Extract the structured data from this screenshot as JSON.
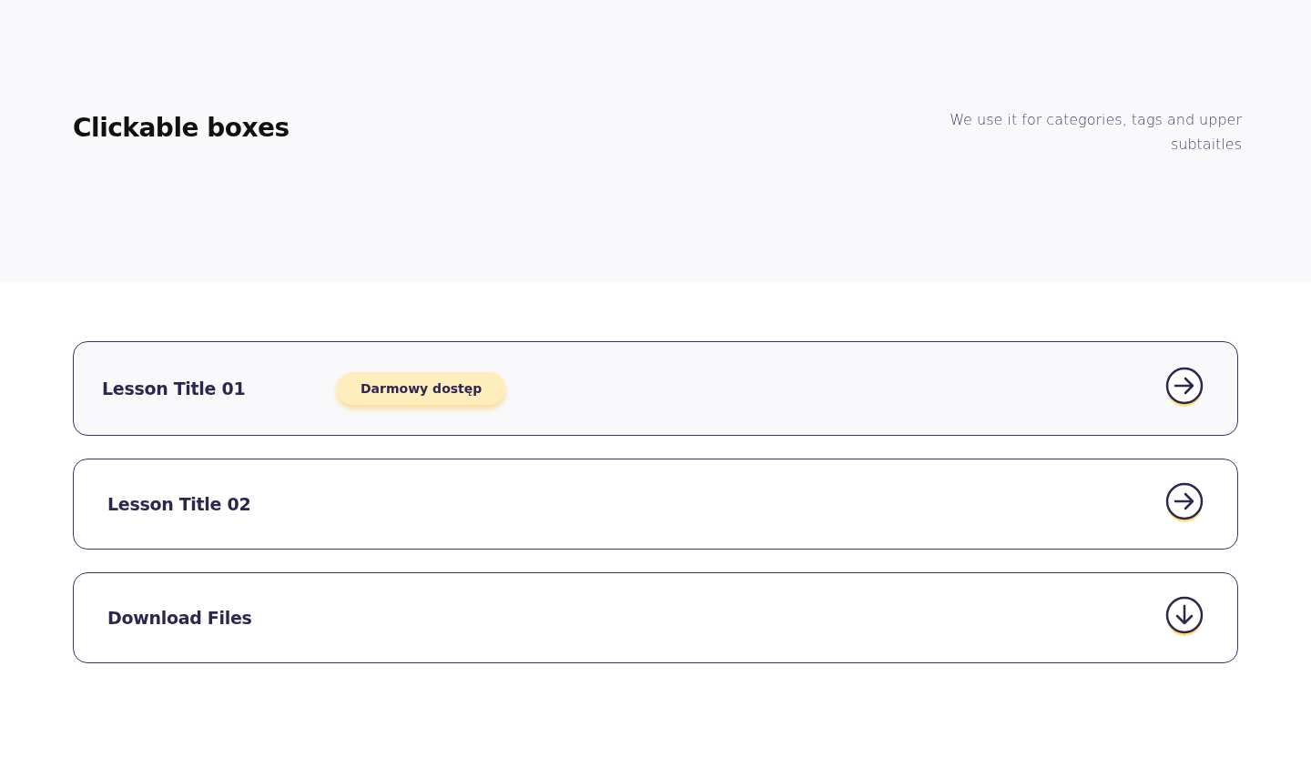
{
  "header": {
    "title": "Clickable boxes",
    "description": "We use it for categories, tags and upper subtaitles"
  },
  "boxes": [
    {
      "title": "Lesson Title 01",
      "selected": true,
      "badge": "Darmowy dostęp",
      "kind": "arrow"
    },
    {
      "title": "Lesson Title 02",
      "selected": false,
      "kind": "arrow"
    },
    {
      "title": "Download Files",
      "selected": false,
      "kind": "download"
    }
  ]
}
